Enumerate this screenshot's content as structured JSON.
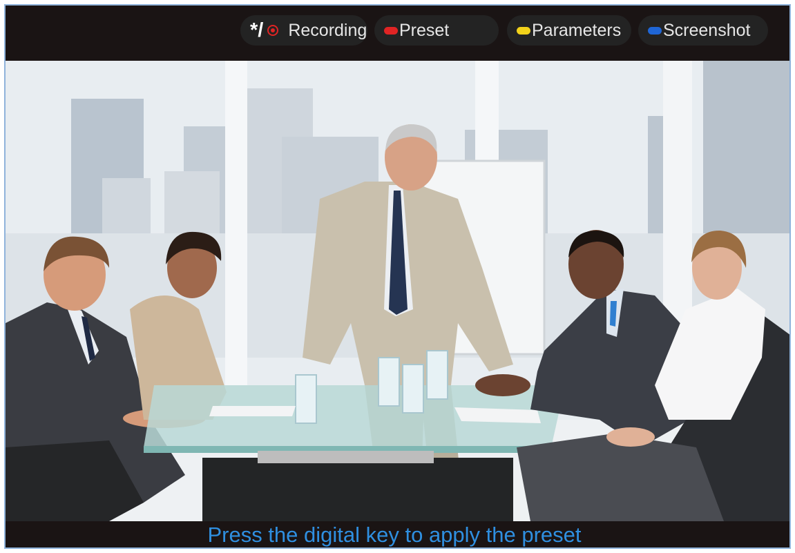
{
  "toolbar": {
    "recording": {
      "glyph": "*/",
      "label": "Recording",
      "icon": "record-icon",
      "color": "#e02424"
    },
    "preset": {
      "label": "Preset",
      "color": "#e02424"
    },
    "parameters": {
      "label": "Parameters",
      "color": "#f2d21a"
    },
    "screenshot": {
      "label": "Screenshot",
      "color": "#1f66d6"
    }
  },
  "video": {
    "scene": "meeting-room-camera-view"
  },
  "hint": {
    "text": "Press the digital key to apply the preset",
    "color": "#2f8fe0"
  }
}
